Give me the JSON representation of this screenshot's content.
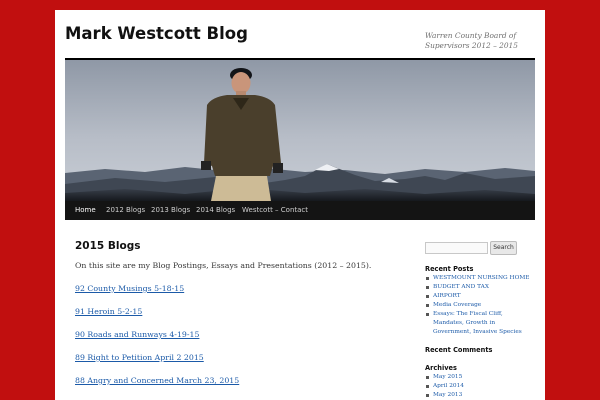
{
  "site": {
    "title": "Mark Westcott Blog",
    "description": "Warren County Board of Supervisors 2012 – 2015"
  },
  "colors": {
    "background": "#c10f0f",
    "nav_bar": "#141414",
    "link": "#1b5aa8"
  },
  "nav": {
    "items": [
      {
        "label": "Home"
      },
      {
        "label": "2012 Blogs"
      },
      {
        "label": "2013 Blogs"
      },
      {
        "label": "2014 Blogs"
      },
      {
        "label": "Westcott – Contact"
      }
    ]
  },
  "content": {
    "title": "2015 Blogs",
    "intro": "On this site are my Blog Postings, Essays and Presentations (2012 – 2015).",
    "posts": [
      {
        "label": "92 County Musings 5-18-15"
      },
      {
        "label": "91 Heroin 5-2-15"
      },
      {
        "label": "90 Roads and Runways 4-19-15"
      },
      {
        "label": "89 Right to Petition April 2 2015"
      },
      {
        "label": "88 Angry and Concerned March 23, 2015"
      }
    ]
  },
  "sidebar": {
    "search": {
      "button_label": "Search",
      "value": ""
    },
    "recent_posts": {
      "title": "Recent Posts",
      "items": [
        {
          "label": "WESTMOUNT NURSING HOME"
        },
        {
          "label": "BUDGET AND TAX"
        },
        {
          "label": "AIRPORT"
        },
        {
          "label": "Media Coverage"
        },
        {
          "label": "Essays: The Fiscal Cliff, Mandates, Growth in Government, Invasive Species"
        }
      ]
    },
    "recent_comments": {
      "title": "Recent Comments"
    },
    "archives": {
      "title": "Archives",
      "items": [
        {
          "label": "May 2015"
        },
        {
          "label": "April 2014"
        },
        {
          "label": "May 2013"
        }
      ]
    }
  }
}
